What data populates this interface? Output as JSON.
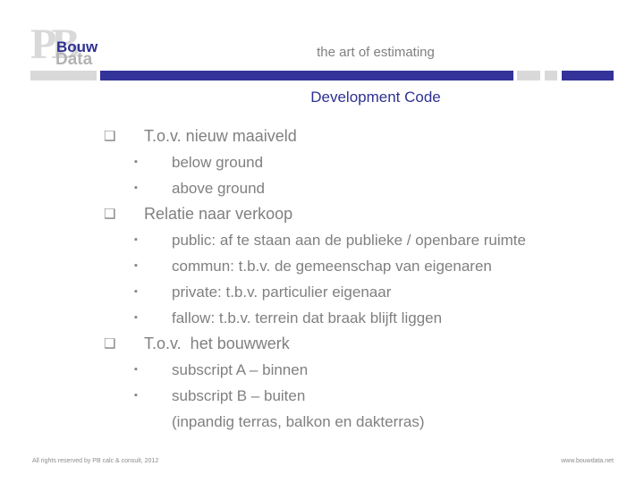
{
  "brand": {
    "watermark": "PB",
    "name_line1": "Bouw",
    "name_line2": "Data",
    "tagline": "the art of estimating",
    "colors": {
      "blue": "#333399",
      "navy": "#2e3192",
      "gray_text": "#808080",
      "gray_bar": "#d9d9d9"
    }
  },
  "header": {
    "subtitle": "Development Code"
  },
  "content": {
    "bullets": [
      {
        "level": 1,
        "marker": "square-hollow-bullet-icon",
        "glyph": "❑",
        "text": "T.o.v. nieuw maaiveld"
      },
      {
        "level": 2,
        "marker": "square-filled-bullet-icon",
        "glyph": "▪",
        "text": "below ground"
      },
      {
        "level": 2,
        "marker": "square-filled-bullet-icon",
        "glyph": "▪",
        "text": "above ground"
      },
      {
        "level": 1,
        "marker": "square-hollow-bullet-icon",
        "glyph": "❑",
        "text": "Relatie naar verkoop"
      },
      {
        "level": 2,
        "marker": "square-filled-bullet-icon",
        "glyph": "▪",
        "text": "public: af te staan aan de publieke / openbare ruimte"
      },
      {
        "level": 2,
        "marker": "square-filled-bullet-icon",
        "glyph": "▪",
        "text": "commun: t.b.v. de gemeenschap van eigenaren"
      },
      {
        "level": 2,
        "marker": "square-filled-bullet-icon",
        "glyph": "▪",
        "text": "private: t.b.v. particulier eigenaar"
      },
      {
        "level": 2,
        "marker": "square-filled-bullet-icon",
        "glyph": "▪",
        "text": "fallow: t.b.v. terrein dat braak blijft liggen"
      },
      {
        "level": 1,
        "marker": "square-hollow-bullet-icon",
        "glyph": "❑",
        "text": "T.o.v.  het bouwwerk"
      },
      {
        "level": 2,
        "marker": "square-filled-bullet-icon",
        "glyph": "▪",
        "text": "subscript A – binnen"
      },
      {
        "level": 2,
        "marker": "square-filled-bullet-icon",
        "glyph": "▪",
        "text": "subscript B – buiten"
      },
      {
        "level": 0,
        "marker": "none",
        "glyph": "",
        "text": "(inpandig terras, balkon en dakterras)"
      }
    ]
  },
  "footer": {
    "copyright": "All rights reserved by PB calc & consult, 2012",
    "website": "www.bouwdata.net"
  }
}
